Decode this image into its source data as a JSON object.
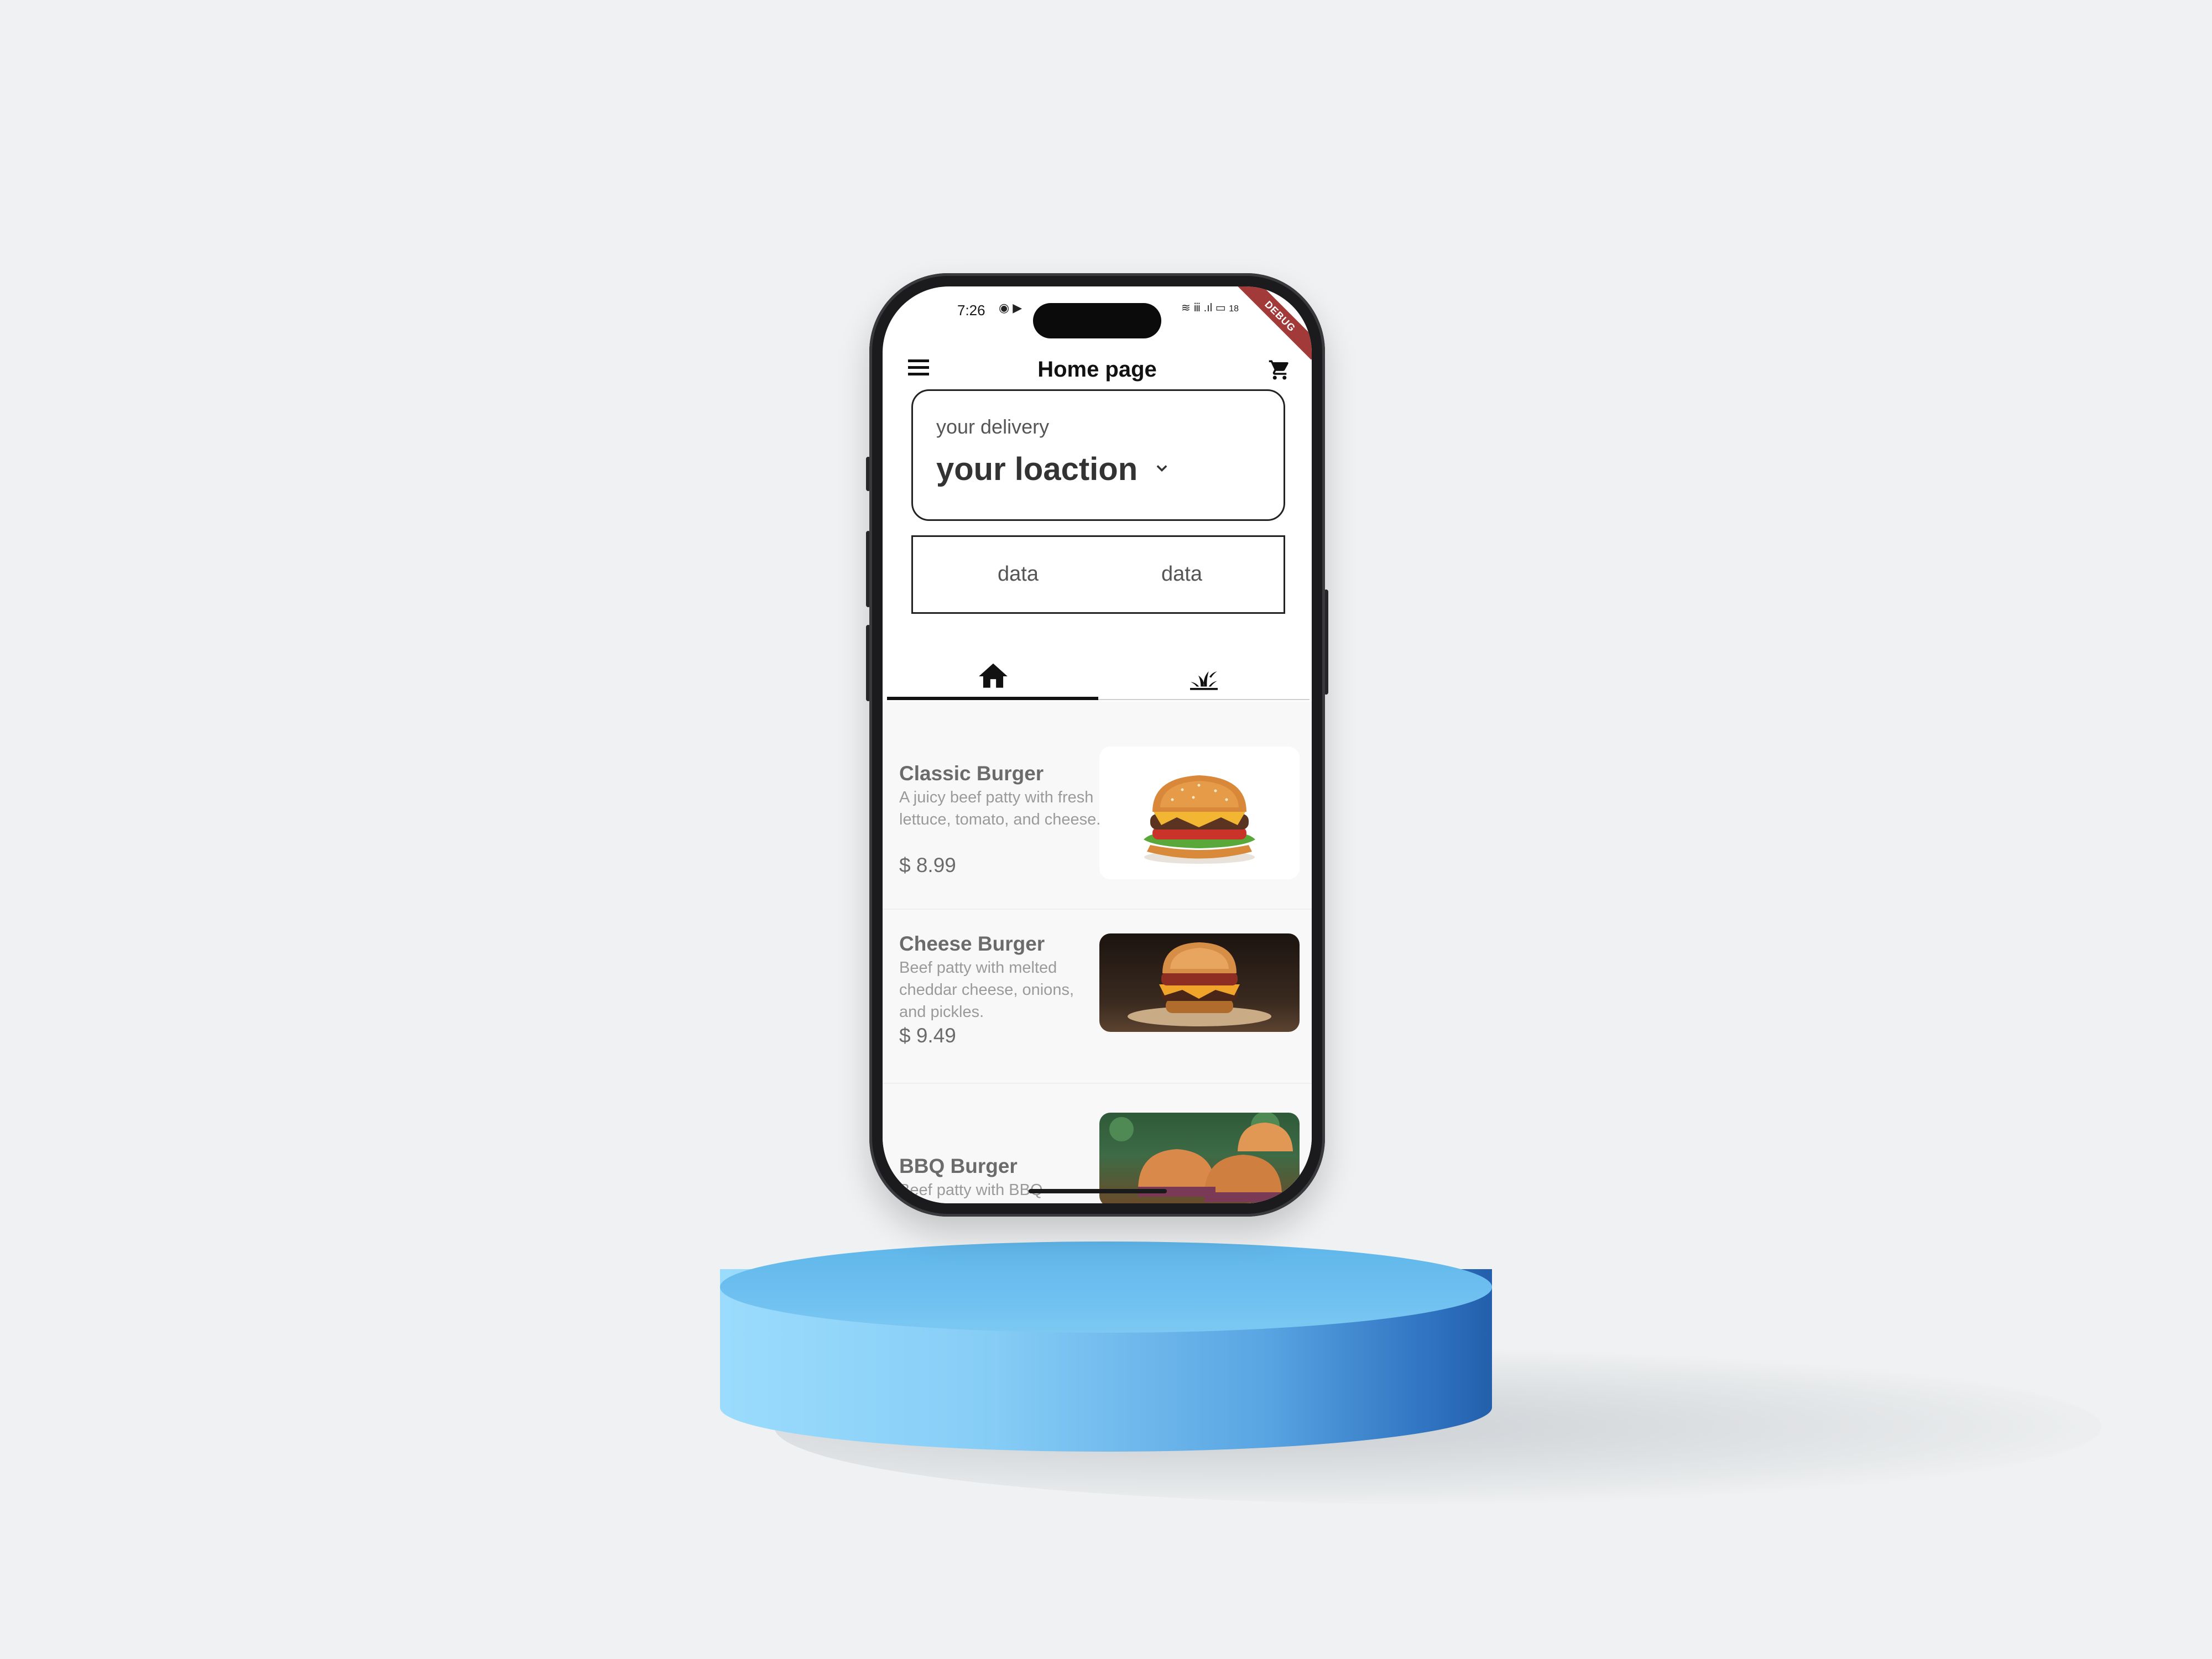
{
  "status_bar": {
    "time": "7:26",
    "app_icons": "◉ ▶",
    "right_icons": "≋ ⅲ .ıl ▭",
    "battery": "18",
    "debug_label": "DEBUG"
  },
  "appbar": {
    "title": "Home page",
    "menu_icon": "menu-icon",
    "cart_icon": "cart-icon"
  },
  "location": {
    "label": "your delivery",
    "value": "your loaction"
  },
  "data_row": {
    "left": "data",
    "right": "data"
  },
  "tabs": [
    {
      "icon": "home-icon",
      "selected": true
    },
    {
      "icon": "plant-icon",
      "selected": false
    }
  ],
  "menu_items": [
    {
      "name": "Classic Burger",
      "description": "A juicy beef patty with fresh lettuce, tomato, and cheese.",
      "price": "$ 8.99"
    },
    {
      "name": "Cheese Burger",
      "description": "Beef patty with melted cheddar cheese, onions, and pickles.",
      "price": "$ 9.49"
    },
    {
      "name": "BBQ Burger",
      "description": "Beef patty with BBQ",
      "price": ""
    }
  ],
  "colors": {
    "background": "#eff1f2",
    "pedestal": "#6ec0f0",
    "frame": "#1b1b1d",
    "text_dark": "#111111",
    "text_muted": "#6b6b6b"
  }
}
